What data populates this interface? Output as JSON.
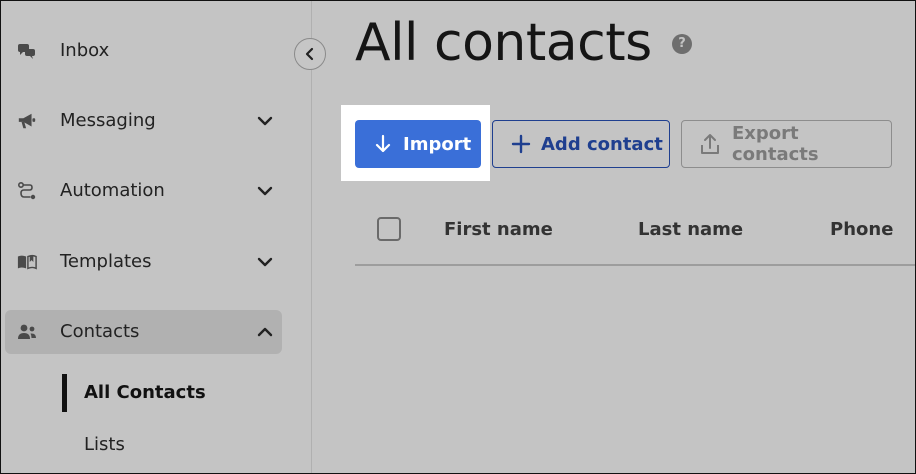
{
  "sidebar": {
    "items": [
      {
        "label": "Inbox",
        "icon": "chat-bubbles-icon"
      },
      {
        "label": "Messaging",
        "icon": "megaphone-icon"
      },
      {
        "label": "Automation",
        "icon": "workflow-icon"
      },
      {
        "label": "Templates",
        "icon": "book-icon"
      },
      {
        "label": "Contacts",
        "icon": "people-icon"
      }
    ],
    "sub_items": [
      {
        "label": "All Contacts"
      },
      {
        "label": "Lists"
      }
    ]
  },
  "main": {
    "title": "All contacts",
    "help_symbol": "?",
    "buttons": {
      "import": "Import",
      "add_contact": "Add contact",
      "export_contacts": "Export contacts"
    },
    "table": {
      "columns": [
        "First name",
        "Last name",
        "Phone"
      ]
    }
  },
  "colors": {
    "primary": "#3a6fd8",
    "secondary_text": "#1f3f8f",
    "background": "#c4c4c4",
    "active_item": "#b1b1b1"
  }
}
